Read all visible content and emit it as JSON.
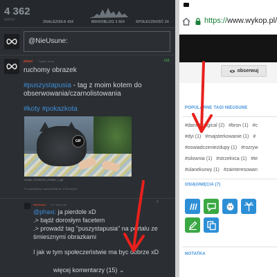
{
  "left": {
    "stats": {
      "count": "4 362",
      "count_sub": "WPISY",
      "znaleziska": "ZNALEZISKA 434",
      "mikroblog": "MIKROBLOG 3 924",
      "spolecznosc": "SPOŁECZNOŚĆ 24"
    },
    "input": {
      "placeholder": "@NieUsune:"
    },
    "post": {
      "author": "phaxi",
      "meta": "7 godz. temu",
      "plus": "+33",
      "line1": "ruchomy obrazek",
      "line2_tag": "#puszystapusia",
      "line2_rest": " - tag z moim kotem do",
      "line3": "obserwowania/czarnolistowania",
      "tag_koty": "#koty",
      "tag_pokaz": "#pokazkota",
      "photo_caption": "źródło: 20190320_224601_1.gif",
      "gif_label": "GIF",
      "like_line": "N. pojedynczy, kopiuj/reklama, 1/39 razy/pl"
    },
    "comment": {
      "author": "NieUsune",
      "meta": "7 hr. temu via",
      "vote": "0",
      "mention": "@phaxi:",
      "line1_rest": " ja pierdole xD",
      "line2": ".> bądź dorosłym facetem",
      "line3": ".> prowadź tag \"puszystapusia\" na portalu ze",
      "line4": "śmiesznymi obrazkami",
      "line5": "I jak w tym społeczeństwie ma byc dobrze xD",
      "more": "więcej komentarzy (15)"
    }
  },
  "right": {
    "url_scheme": "https://",
    "url_host": "www.wykop.pl/",
    "observe": "obserwuj",
    "tags_title": "POPULARNE TAGI NIEUSUNE",
    "tags": [
      [
        "#danielmagical (2)",
        "#bron (1)",
        "#c"
      ],
      [
        "#dyi (1)",
        "#majsterkowanie (1)",
        "#"
      ],
      [
        "#oswiadczeniezdupy (1)",
        "#rozryw"
      ],
      [
        "#silownia (1)",
        "#strzelnica (1)",
        "#te"
      ],
      [
        "#ulanekurwy (1)",
        "#zainteresowan"
      ]
    ],
    "achievements_title": "OSIĄGNIĘCIA (7)",
    "notes_title": "NOTATKA"
  },
  "colors": {
    "dark_bg": "#2b2e33",
    "accent_blue": "#3d8fd8",
    "author_red": "#d14b2e",
    "arrow_red": "#e8201c"
  }
}
